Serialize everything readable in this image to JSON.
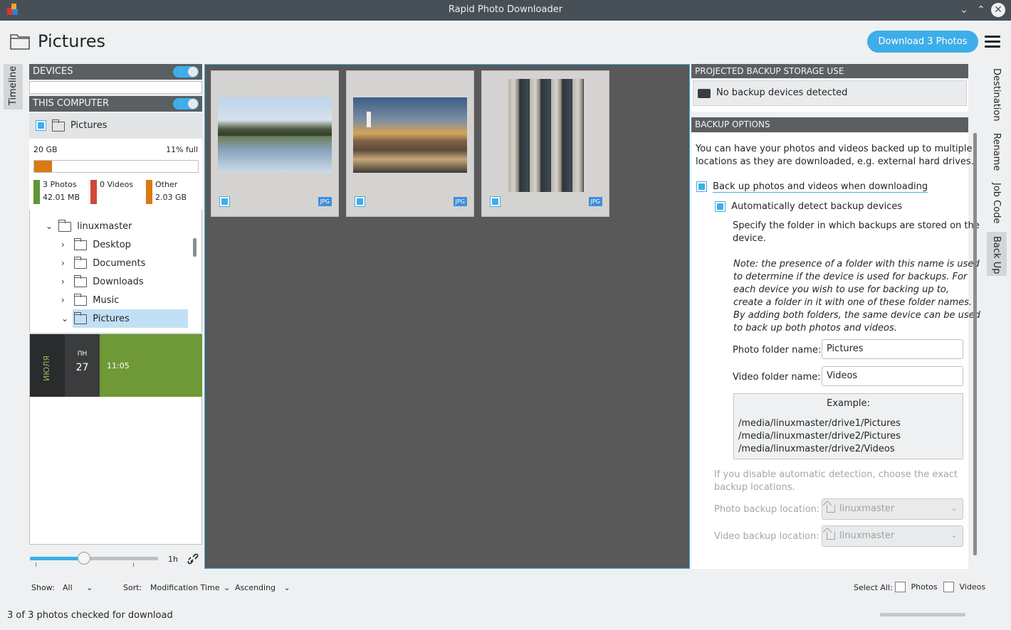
{
  "window": {
    "title": "Rapid Photo Downloader"
  },
  "header": {
    "title": "Pictures",
    "download_label": "Download 3 Photos"
  },
  "left_tabs": {
    "timeline": "Timeline"
  },
  "devices": {
    "heading": "DEVICES"
  },
  "this_computer": {
    "heading": "THIS COMPUTER",
    "source_label": "Pictures",
    "capacity": "20 GB",
    "percent_full": "11% full",
    "usage_fraction": 0.11,
    "photos_label": "3 Photos",
    "photos_size": "42.01 MB",
    "videos_label": "0 Videos",
    "other_label": "Other",
    "other_size": "2.03 GB",
    "colors": {
      "photos": "#5f9733",
      "videos": "#d1473a",
      "other": "#d97a10"
    }
  },
  "tree": {
    "root": "linuxmaster",
    "items": [
      "Desktop",
      "Documents",
      "Downloads",
      "Music",
      "Pictures"
    ]
  },
  "timeline": {
    "month": "ИЮЛЯ",
    "weekday": "ПН",
    "day": "27",
    "time": "11:05"
  },
  "slider": {
    "value_label": "1h"
  },
  "thumbnails": [
    {
      "type": "JPG",
      "checked": true
    },
    {
      "type": "JPG",
      "checked": true
    },
    {
      "type": "JPG",
      "checked": true
    }
  ],
  "backup_storage": {
    "heading": "PROJECTED BACKUP STORAGE USE",
    "status": "No backup devices detected"
  },
  "backup_options": {
    "heading": "BACKUP OPTIONS",
    "intro_1": "You can have your photos and videos backed up to multiple",
    "intro_2": "locations as they are downloaded, e.g. external hard drives.",
    "backup_checkbox": "Back up photos and videos when downloading",
    "auto_detect_checkbox": "Automatically detect backup devices",
    "specify_1": "Specify the folder in which backups are stored on the",
    "specify_2": "device.",
    "note_lines": [
      "Note: the presence of a folder with this name is used",
      "to determine if the device is used for backups. For",
      "each device you wish to use for backing up to,",
      "create a folder in it with one of these folder names.",
      "By adding both folders, the same device can be used",
      "to back up both photos and videos."
    ],
    "photo_folder_label": "Photo folder name:",
    "photo_folder_value": "Pictures",
    "video_folder_label": "Video folder name:",
    "video_folder_value": "Videos",
    "example_title": "Example:",
    "example_lines": [
      "/media/linuxmaster/drive1/Pictures",
      "/media/linuxmaster/drive2/Pictures",
      "/media/linuxmaster/drive2/Videos"
    ],
    "disable_1": "If you disable automatic detection, choose the exact",
    "disable_2": "backup locations.",
    "photo_backup_label": "Photo backup location:",
    "photo_backup_value": "linuxmaster",
    "video_backup_label": "Video backup location:",
    "video_backup_value": "linuxmaster"
  },
  "right_tabs": [
    "Destination",
    "Rename",
    "Job Code",
    "Back Up"
  ],
  "bottom": {
    "show_label": "Show:",
    "show_value": "All",
    "sort_label": "Sort:",
    "sort_value": "Modification Time",
    "order_value": "Ascending",
    "select_all_label": "Select All:",
    "photos_label": "Photos",
    "videos_label": "Videos",
    "status": "3 of 3 photos checked for download"
  }
}
